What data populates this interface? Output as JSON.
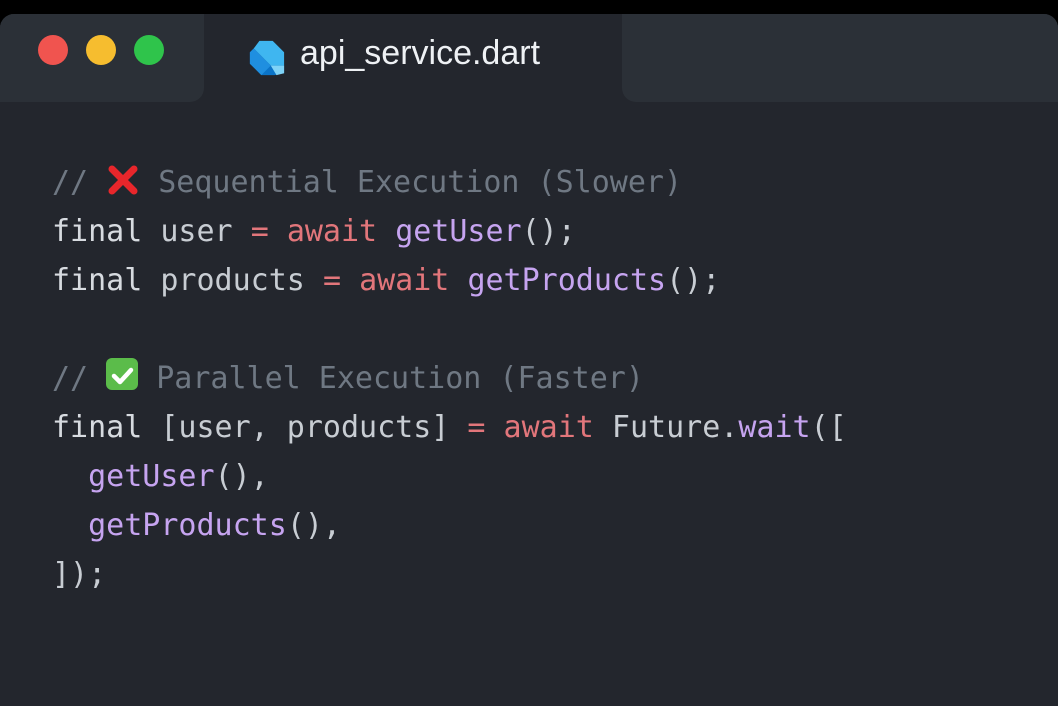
{
  "window": {
    "colors": {
      "background": "#23262d",
      "titlebar": "#2b3037",
      "close": "#f0544f",
      "minimize": "#f6bd2f",
      "maximize": "#2fc44b",
      "comment": "#6f7883",
      "keyword": "#d7dbe0",
      "operator": "#e2767b",
      "function": "#c6a4f0"
    },
    "controls": [
      "close-icon",
      "minimize-icon",
      "maximize-icon"
    ]
  },
  "tab": {
    "icon": "dart-icon",
    "title": "api_service.dart"
  },
  "code": {
    "lines": [
      {
        "tokens": [
          {
            "t": "// ",
            "c": "comment"
          },
          {
            "icon": "cross-mark-icon"
          },
          {
            "t": " Sequential Execution (Slower)",
            "c": "comment"
          }
        ]
      },
      {
        "tokens": [
          {
            "t": "final",
            "c": "kw"
          },
          {
            "t": " user ",
            "c": "ident"
          },
          {
            "t": "=",
            "c": "op"
          },
          {
            "t": " ",
            "c": "ident"
          },
          {
            "t": "await",
            "c": "await"
          },
          {
            "t": " ",
            "c": "ident"
          },
          {
            "t": "getUser",
            "c": "fn"
          },
          {
            "t": "();",
            "c": "punc"
          }
        ]
      },
      {
        "tokens": [
          {
            "t": "final",
            "c": "kw"
          },
          {
            "t": " products ",
            "c": "ident"
          },
          {
            "t": "=",
            "c": "op"
          },
          {
            "t": " ",
            "c": "ident"
          },
          {
            "t": "await",
            "c": "await"
          },
          {
            "t": " ",
            "c": "ident"
          },
          {
            "t": "getProducts",
            "c": "fn"
          },
          {
            "t": "();",
            "c": "punc"
          }
        ]
      },
      {
        "tokens": []
      },
      {
        "tokens": [
          {
            "t": "// ",
            "c": "comment"
          },
          {
            "icon": "check-mark-icon"
          },
          {
            "t": " Parallel Execution (Faster)",
            "c": "comment"
          }
        ]
      },
      {
        "tokens": [
          {
            "t": "final",
            "c": "kw"
          },
          {
            "t": " [user, products] ",
            "c": "ident"
          },
          {
            "t": "=",
            "c": "op"
          },
          {
            "t": " ",
            "c": "ident"
          },
          {
            "t": "await",
            "c": "await"
          },
          {
            "t": " Future.",
            "c": "ident"
          },
          {
            "t": "wait",
            "c": "fn"
          },
          {
            "t": "([",
            "c": "punc"
          }
        ]
      },
      {
        "tokens": [
          {
            "t": "  ",
            "c": "ident"
          },
          {
            "t": "getUser",
            "c": "fn"
          },
          {
            "t": "(),",
            "c": "punc"
          }
        ]
      },
      {
        "tokens": [
          {
            "t": "  ",
            "c": "ident"
          },
          {
            "t": "getProducts",
            "c": "fn"
          },
          {
            "t": "(),",
            "c": "punc"
          }
        ]
      },
      {
        "tokens": [
          {
            "t": "]);",
            "c": "punc"
          }
        ]
      }
    ]
  }
}
